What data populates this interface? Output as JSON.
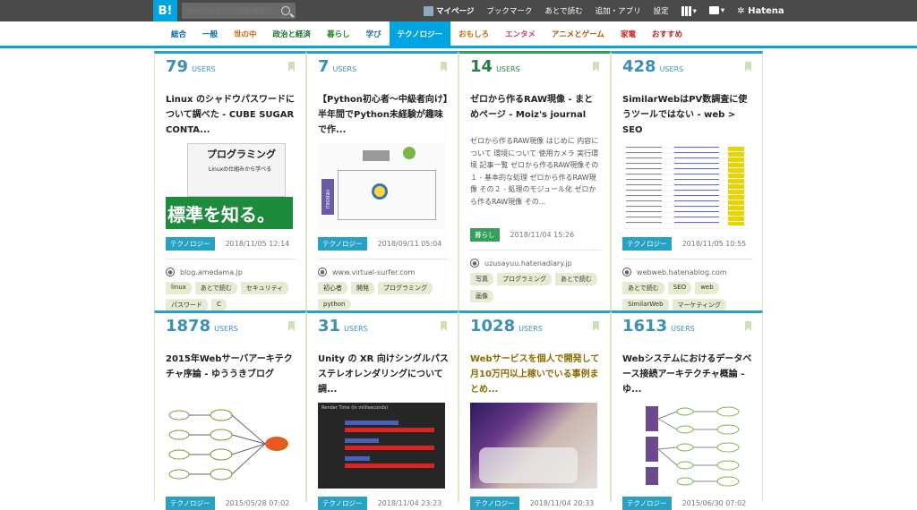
{
  "topbar": {
    "logo": "B!",
    "search_placeholder": "キーワード・URLを検索",
    "mypage": "マイページ",
    "bookmark": "ブックマーク",
    "later": "あとで読む",
    "add_app": "追加・アプリ",
    "settings": "設定",
    "brand": "Hatena"
  },
  "categories": [
    "総合",
    "一般",
    "世の中",
    "政治と経済",
    "暮らし",
    "学び",
    "テクノロジー",
    "おもしろ",
    "エンタメ",
    "アニメとゲーム",
    "家電",
    "おすすめ"
  ],
  "category_colors": [
    "#0a6da7",
    "#0a6da7",
    "#d06010",
    "#1a6c2c",
    "#2a8a2a",
    "#1b6db0",
    "#ffffff",
    "#c86a00",
    "#d04080",
    "#b05000",
    "#cc2222",
    "#c02020"
  ],
  "users_label": "USERS",
  "cards": [
    {
      "count": "79",
      "title": "Linux のシャドウパスワードについて調べた - CUBE SUGAR CONTA...",
      "category": "テクノロジー",
      "date": "2018/11/05 12:14",
      "site": "blog.amedama.jp",
      "tags": [
        "linux",
        "あとで読む",
        "セキュリティ",
        "パスワード",
        "C"
      ],
      "thumb": {
        "title": "プログラミング",
        "sub": "Linuxの仕組みから学べる",
        "big": "標準を知る。"
      }
    },
    {
      "count": "7",
      "title": "【Python初心者〜中級者向け】半年間でPython未経験が趣味で作...",
      "category": "テクノロジー",
      "date": "2018/09/11 05:04",
      "site": "www.virtual-surfer.com",
      "tags": [
        "初心者",
        "開発",
        "プログラミング",
        "python"
      ],
      "thumb": {
        "heroku": "HEROKU"
      }
    },
    {
      "count": "14",
      "title": "ゼロから作るRAW現像 - まとめページ - Moiz's journal",
      "summary": "ゼロから作るRAW現像 はじめに 内容について 環境について 使用カメラ 実行環境 記事一覧 ゼロから作るRAW現像その１ - 基本的な処理 ゼロから作るRAW現像 その２ - 処理のモジュール化 ゼロから作るRAW現像 その...",
      "category": "暮らし",
      "date": "2018/11/04 15:26",
      "site": "uzusayuu.hatenadiary.jp",
      "tags": [
        "写真",
        "プログラミング",
        "あとで読む",
        "画像"
      ]
    },
    {
      "count": "428",
      "title": "SimilarWebはPV数調査に使うツールではない - web > SEO",
      "category": "テクノロジー",
      "date": "2018/11/05 10:55",
      "site": "webweb.hatenablog.com",
      "tags": [
        "あとで読む",
        "SEO",
        "web",
        "SimilarWeb",
        "マーケティング"
      ]
    },
    {
      "count": "1878",
      "title": "2015年Webサーバアーキテクチャ序論 - ゆううきブログ",
      "category": "テクノロジー",
      "date": "2015/05/28 07:02"
    },
    {
      "count": "31",
      "title": "Unity の XR 向けシングルパスステレオレンダリングについて調...",
      "category": "テクノロジー",
      "date": "2018/11/04 23:23",
      "thumb": {
        "axis": "Render Time (in milliseconds)"
      }
    },
    {
      "count": "1028",
      "title": "Webサービスを個人で開発して月10万円以上稼いでいる事例まとめ...",
      "category": "テクノロジー",
      "date": "2018/11/04 20:33"
    },
    {
      "count": "1613",
      "title": "Webシステムにおけるデータベース接続アーキテクチャ概論 - ゆ...",
      "category": "テクノロジー",
      "date": "2015/06/30 07:02"
    }
  ]
}
